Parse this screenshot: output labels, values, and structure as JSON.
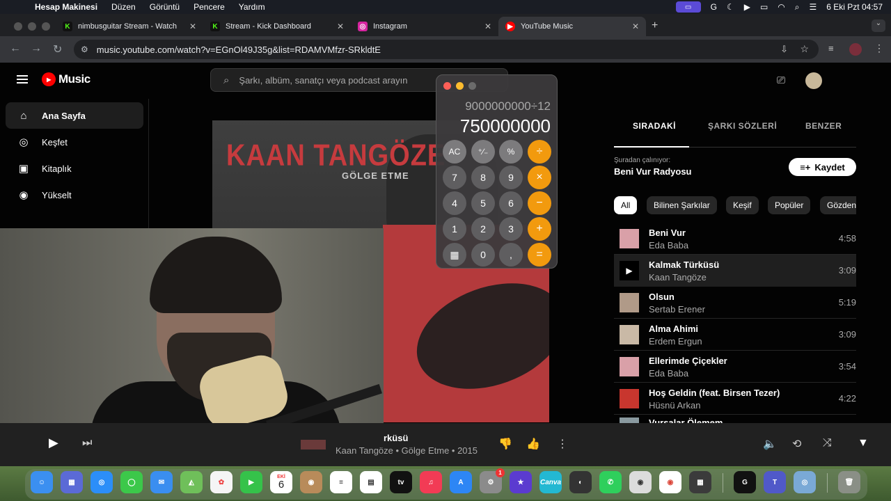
{
  "menubar": {
    "app_name": "Hesap Makinesi",
    "items": [
      "Düzen",
      "Görüntü",
      "Pencere",
      "Yardım"
    ],
    "datetime": "6 Eki Pzt  04:57"
  },
  "tabs": [
    {
      "label": "nimbusguitar Stream - Watch",
      "favicon": "K",
      "color": "#53fc18"
    },
    {
      "label": "Stream - Kick Dashboard",
      "favicon": "K",
      "color": "#53fc18"
    },
    {
      "label": "Instagram",
      "favicon": "◎",
      "color": "#d6249f"
    },
    {
      "label": "YouTube Music",
      "favicon": "▶",
      "color": "#ff0000"
    }
  ],
  "address": {
    "url": "music.youtube.com/watch?v=EGnOl49J35g&list=RDAMVMfzr-SRkldtE"
  },
  "yt": {
    "logo_text": "Music",
    "search_placeholder": "Şarkı, albüm, sanatçı veya podcast arayın",
    "sidebar": [
      {
        "label": "Ana Sayfa",
        "icon": "home-icon",
        "glyph": "⌂"
      },
      {
        "label": "Keşfet",
        "icon": "compass-icon",
        "glyph": "◎"
      },
      {
        "label": "Kitaplık",
        "icon": "library-icon",
        "glyph": "▣"
      },
      {
        "label": "Yükselt",
        "icon": "upgrade-icon",
        "glyph": "◉"
      }
    ]
  },
  "album": {
    "artist": "KAAN TANGÖZE",
    "subtitle": "GÖLGE ETME"
  },
  "calculator": {
    "expression": "9000000000÷12",
    "display": "750000000",
    "buttons": [
      [
        "AC",
        "⁺∕₋",
        "%",
        "÷"
      ],
      [
        "7",
        "8",
        "9",
        "×"
      ],
      [
        "4",
        "5",
        "6",
        "−"
      ],
      [
        "1",
        "2",
        "3",
        "+"
      ],
      [
        "▦",
        "0",
        ",",
        "="
      ]
    ]
  },
  "panel": {
    "tabs": [
      "SIRADAKİ",
      "ŞARKI SÖZLERİ",
      "BENZER"
    ],
    "from_label": "Şuradan çalınıyor:",
    "from_value": "Beni Vur Radyosu",
    "save_label": "Kaydet",
    "chips": [
      "All",
      "Bilinen Şarkılar",
      "Keşif",
      "Popüler",
      "Gözden"
    ],
    "queue": [
      {
        "title": "Beni Vur",
        "artist": "Eda Baba",
        "duration": "4:58",
        "color": "#d9a0a8"
      },
      {
        "title": "Kalmak Türküsü",
        "artist": "Kaan Tangöze",
        "duration": "3:09",
        "color": "#000000"
      },
      {
        "title": "Olsun",
        "artist": "Sertab Erener",
        "duration": "5:19",
        "color": "#b09a88"
      },
      {
        "title": "Alma Ahimi",
        "artist": "Erdem Ergun",
        "duration": "3:09",
        "color": "#c9b9a6"
      },
      {
        "title": "Ellerimde Çiçekler",
        "artist": "Eda Baba",
        "duration": "3:54",
        "color": "#d9a0a8"
      },
      {
        "title": "Hoş Geldin (feat. Birsen Tezer)",
        "artist": "Hüsnü Arkan",
        "duration": "4:22",
        "color": "#c8362e"
      },
      {
        "title": "Vursalar Ölemem",
        "artist": "",
        "duration": "",
        "color": "#8a9aa0"
      }
    ]
  },
  "player": {
    "title_fragment": "rküsü",
    "subtitle": "Kaan Tangöze • Gölge Etme • 2015"
  },
  "dock": {
    "calendar_month": "EKİ",
    "calendar_day": "6",
    "appletv_label": "tv",
    "canva_label": "Canva",
    "settings_badge": "1"
  }
}
